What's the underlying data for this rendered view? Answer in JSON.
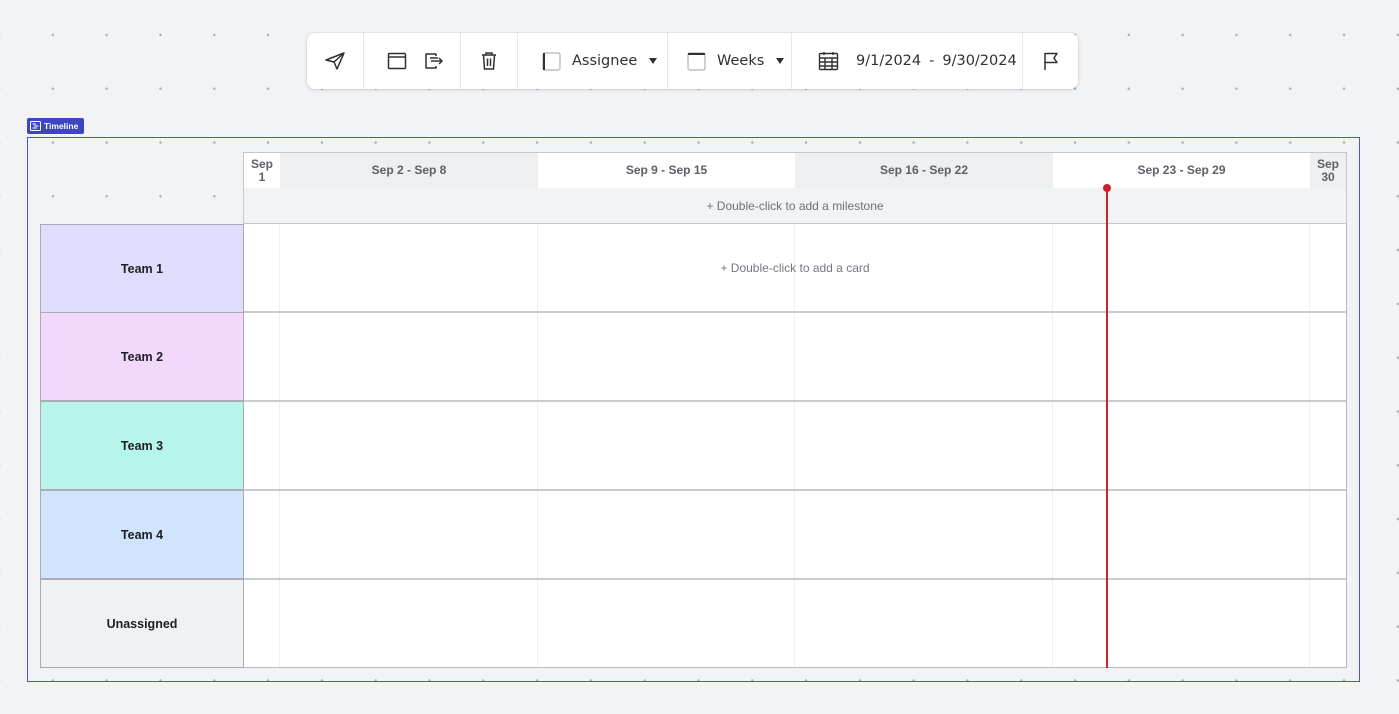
{
  "toolbar": {
    "share_icon": "send-icon",
    "frame_icon": "window-icon",
    "export_icon": "export-icon",
    "delete_icon": "trash-icon",
    "assignee_label": "Assignee",
    "weeks_label": "Weeks",
    "calendar_icon": "calendar-icon",
    "date_start": "9/1/2024",
    "date_separator": "-",
    "date_end": "9/30/2024",
    "flag_icon": "flag-icon"
  },
  "tag": {
    "label": "Timeline",
    "icon": "timeline-icon"
  },
  "header": {
    "weeks": [
      {
        "label": "Sep 1"
      },
      {
        "label": "Sep 2 - Sep 8"
      },
      {
        "label": "Sep 9 - Sep 15"
      },
      {
        "label": "Sep 16 - Sep 22"
      },
      {
        "label": "Sep 23 - Sep 29"
      },
      {
        "label": "Sep 30"
      }
    ],
    "week0_line1": "Sep",
    "week0_line2": "1",
    "week5_line1": "Sep",
    "week5_line2": "30"
  },
  "milestone_hint": "+ Double-click to add a milestone",
  "card_hint": "+ Double-click to add a card",
  "rows": [
    {
      "label": "Team 1",
      "color": "#dfdcfd"
    },
    {
      "label": "Team 2",
      "color": "#f2d8fd"
    },
    {
      "label": "Team 3",
      "color": "#b7f4ea"
    },
    {
      "label": "Team 4",
      "color": "#d1e4fe"
    },
    {
      "label": "Unassigned",
      "color": "#f0f1f2"
    }
  ],
  "colors": {
    "today_line": "#d01f2d",
    "frame_border": "#4e55d0",
    "tag_bg": "#3e45c2"
  }
}
